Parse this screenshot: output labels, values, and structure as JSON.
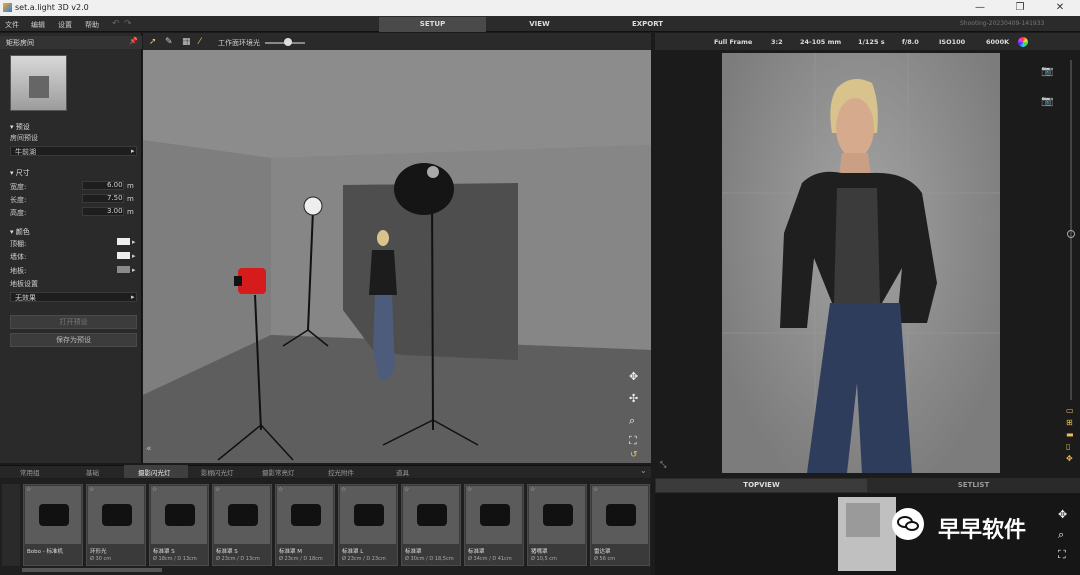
{
  "titlebar": {
    "title": "set.a.light 3D v2.0"
  },
  "menu": [
    "文件",
    "编辑",
    "设置",
    "帮助"
  ],
  "tabs": [
    "SETUP",
    "VIEW",
    "EXPORT"
  ],
  "shooting": "Shooting-20230409-141933",
  "left": {
    "header": "矩形房间",
    "preset_section": "预设",
    "room_preset_label": "房间预设",
    "room_preset_value": "牛前湖",
    "size_section": "尺寸",
    "width_label": "宽度:",
    "width_value": "6.00",
    "length_label": "长度:",
    "length_value": "7.50",
    "height_label": "高度:",
    "height_value": "3.00",
    "unit": "m",
    "color_section": "颜色",
    "wall_label": "顶棚:",
    "ceil_label": "墙体:",
    "floor_label": "地板:",
    "floor_mat_label": "地板设置",
    "floor_mat_value": "无效果",
    "load_btn": "打开预设",
    "save_btn": "保存为预设"
  },
  "viewport": {
    "workspace_label": "工作面环境光"
  },
  "camera": {
    "frame": "Full Frame",
    "ratio": "3:2",
    "lens": "24-105 mm",
    "shutter": "1/125 s",
    "aperture": "f/8.0",
    "iso": "ISO100",
    "kelvin": "6000K"
  },
  "right_tabs": [
    "TOPVIEW",
    "SETLIST"
  ],
  "watermark": "早早软件",
  "bottom_tabs": [
    "常用组",
    "基础",
    "摄影闪光灯",
    "影棚闪光灯",
    "摄影常亮灯",
    "控光附件",
    "道具"
  ],
  "lights": [
    {
      "name": "Bobo - 标准机",
      "size": ""
    },
    {
      "name": "环形光",
      "size": "Ø 30 cm"
    },
    {
      "name": "标准罩 S",
      "size": "Ø 18cm / D 13cm"
    },
    {
      "name": "标准罩 S",
      "size": "Ø 23cm / D 13cm"
    },
    {
      "name": "标准罩 M",
      "size": "Ø 23cm / D 18cm"
    },
    {
      "name": "标准罩 L",
      "size": "Ø 23cm / D 23cm"
    },
    {
      "name": "标准罩",
      "size": "Ø 30cm / D 18,5cm"
    },
    {
      "name": "标准罩",
      "size": "Ø 34cm / D 41cm"
    },
    {
      "name": "猪嘴罩",
      "size": "Ø 10,5 cm"
    },
    {
      "name": "雷达罩",
      "size": "Ø 56 cm"
    }
  ]
}
